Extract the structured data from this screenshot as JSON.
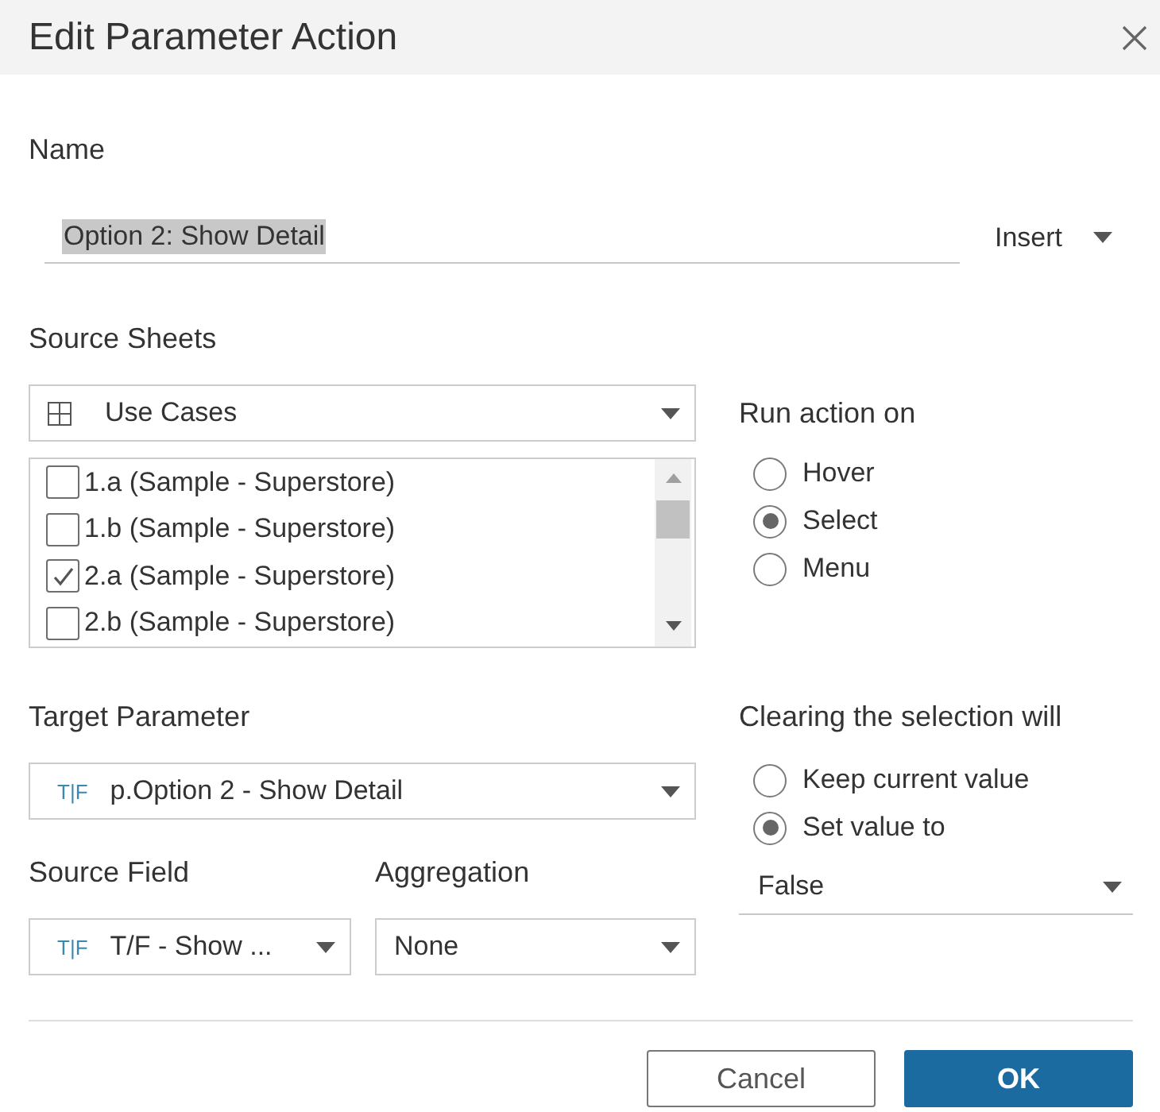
{
  "dialog": {
    "title": "Edit Parameter Action"
  },
  "name": {
    "label": "Name",
    "value": "Option 2: Show Detail",
    "value_selected": true,
    "insert_menu": "Insert"
  },
  "source_sheets": {
    "label": "Source Sheets",
    "dropdown": "Use Cases",
    "sheets": [
      {
        "label": "1.a (Sample - Superstore)",
        "checked": false
      },
      {
        "label": "1.b (Sample - Superstore)",
        "checked": false
      },
      {
        "label": "2.a (Sample - Superstore)",
        "checked": true
      },
      {
        "label": "2.b (Sample - Superstore)",
        "checked": false
      }
    ]
  },
  "run_action_on": {
    "label": "Run action on",
    "options": [
      {
        "label": "Hover",
        "selected": false
      },
      {
        "label": "Select",
        "selected": true
      },
      {
        "label": "Menu",
        "selected": false
      }
    ]
  },
  "target_parameter": {
    "label": "Target Parameter",
    "type_badge": "T|F",
    "value": "p.Option 2 - Show Detail"
  },
  "source_field": {
    "label": "Source Field",
    "type_badge": "T|F",
    "value": "T/F - Show ..."
  },
  "aggregation": {
    "label": "Aggregation",
    "value": "None"
  },
  "clearing": {
    "label": "Clearing the selection will",
    "options": [
      {
        "label": "Keep current value",
        "selected": false
      },
      {
        "label": "Set value to",
        "selected": true
      }
    ],
    "value": "False"
  },
  "buttons": [
    {
      "label": "Cancel",
      "kind": "secondary"
    },
    {
      "label": "OK",
      "kind": "primary"
    }
  ]
}
